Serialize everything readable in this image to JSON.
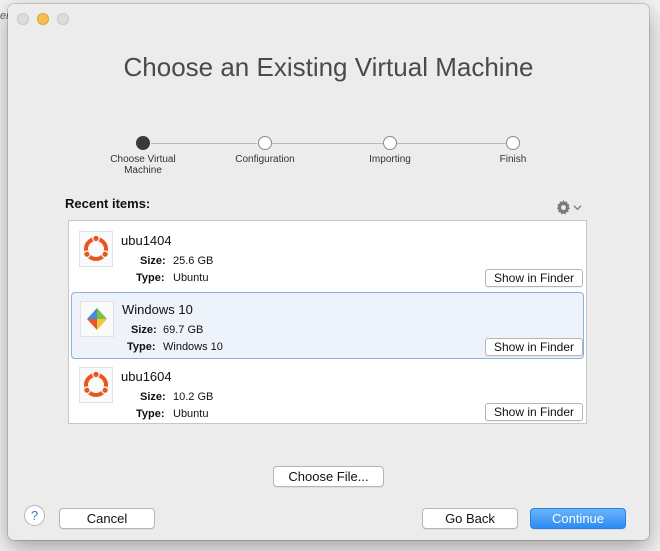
{
  "window": {
    "title": "Choose an Existing Virtual Machine"
  },
  "stepper": {
    "steps": [
      {
        "label": "Choose Virtual Machine",
        "active": true
      },
      {
        "label": "Configuration",
        "active": false
      },
      {
        "label": "Importing",
        "active": false
      },
      {
        "label": "Finish",
        "active": false
      }
    ]
  },
  "recent": {
    "label": "Recent items:",
    "items": [
      {
        "name": "ubu1404",
        "size_label": "Size:",
        "size": "25.6 GB",
        "type_label": "Type:",
        "type": "Ubuntu",
        "icon": "ubuntu-icon",
        "selected": false,
        "finder_label": "Show in Finder"
      },
      {
        "name": "Windows 10",
        "size_label": "Size:",
        "size": "69.7 GB",
        "type_label": "Type:",
        "type": "Windows 10",
        "icon": "windows-icon",
        "selected": true,
        "finder_label": "Show in Finder"
      },
      {
        "name": "ubu1604",
        "size_label": "Size:",
        "size": "10.2 GB",
        "type_label": "Type:",
        "type": "Ubuntu",
        "icon": "ubuntu-icon",
        "selected": false,
        "finder_label": "Show in Finder"
      }
    ]
  },
  "buttons": {
    "choose_file": "Choose File...",
    "cancel": "Cancel",
    "go_back": "Go Back",
    "continue": "Continue",
    "help": "?"
  },
  "colors": {
    "accent": "#2a8cf5",
    "selection_bg": "#eef3fb",
    "selection_border": "#8ab0e0",
    "ubuntu_orange": "#e95420"
  }
}
